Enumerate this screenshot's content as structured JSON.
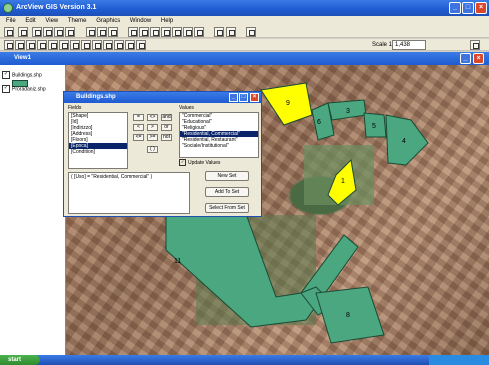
{
  "app": {
    "title": "ArcView GIS Version 3.1",
    "menus": [
      "File",
      "Edit",
      "View",
      "Theme",
      "Graphics",
      "Window",
      "Help"
    ]
  },
  "toolbar": {
    "scale_label": "Scale 1:",
    "scale_value": "1,438"
  },
  "view": {
    "title": "View1"
  },
  "toc": {
    "items": [
      {
        "label": "Buildings.shp",
        "checked": true
      },
      {
        "label": "Proradaniz.shp",
        "checked": true
      }
    ]
  },
  "dialog": {
    "title": "Buildings.shp",
    "fields_label": "Fields",
    "values_label": "Values",
    "fields": [
      "[Shape]",
      "[Id]",
      "[Indirizzo]",
      "[Address]",
      "[Floors]",
      "[Epoca]",
      "[Condition]"
    ],
    "selected_field": 5,
    "values": [
      "\"Commercial\"",
      "\"Educational\"",
      "\"Religious\"",
      "\"Residential, Commercial\"",
      "\"Residential, Restaurant\"",
      "\"Sociale/Institutional\""
    ],
    "selected_value": 3,
    "operators": [
      "=",
      "<>",
      "and",
      "<",
      ">",
      "or",
      "<=",
      ">=",
      "not",
      "( )"
    ],
    "update_values_label": "Update Values",
    "expression": "( [Uso] = \"Residential, Commercial\" )",
    "buttons": {
      "new_set": "New Set",
      "add_to_set": "Add To Set",
      "select_from_set": "Select From Set"
    }
  },
  "map": {
    "labels": [
      "9",
      "6",
      "3",
      "5",
      "4",
      "1",
      "11",
      "8"
    ]
  },
  "taskbar": {
    "start_label": "start"
  },
  "colors": {
    "selected": "#ffff00",
    "feature": "#4ba77f",
    "outline": "#1a4a35"
  }
}
